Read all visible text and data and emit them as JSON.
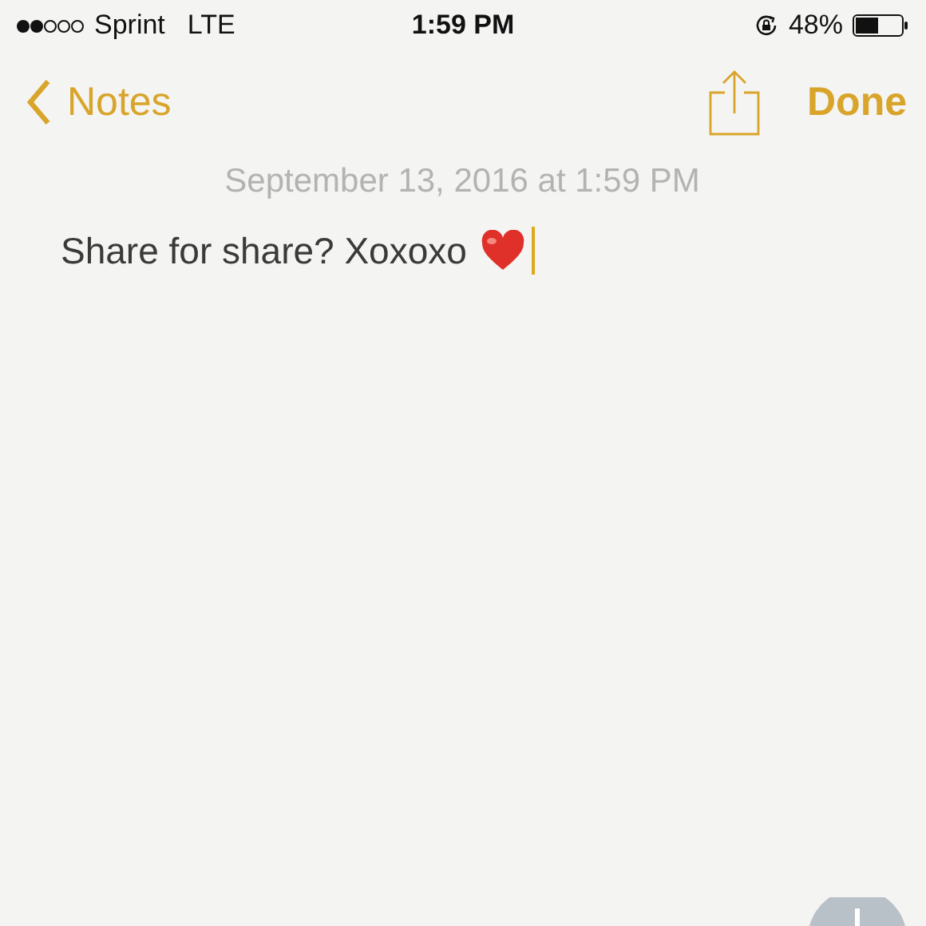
{
  "status_bar": {
    "carrier": "Sprint",
    "network": "LTE",
    "time": "1:59 PM",
    "battery": "48%"
  },
  "nav": {
    "back": "Notes",
    "done": "Done"
  },
  "note": {
    "date": "September 13, 2016 at 1:59 PM",
    "body": "Share for share? Xoxoxo"
  }
}
